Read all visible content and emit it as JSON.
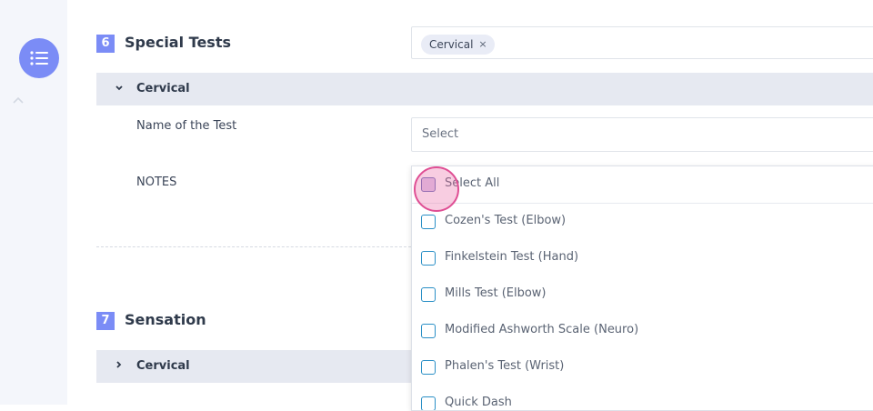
{
  "rail": {
    "menu_icon": "list-icon",
    "up_icon": "chevron-up-icon"
  },
  "sections": [
    {
      "number": "6",
      "title": "Special Tests"
    },
    {
      "number": "7",
      "title": "Sensation"
    }
  ],
  "special_tests": {
    "chip_label": "Cervical",
    "chip_remove": "×",
    "band_label": "Cervical",
    "test_name_label": "Name of the Test",
    "select_placeholder": "Select",
    "notes_label": "NOTES"
  },
  "sensation": {
    "band_label": "Cervical"
  },
  "dropdown": {
    "select_all": "Select All",
    "options": [
      "Cozen's Test (Elbow)",
      "Finkelstein Test (Hand)",
      "Mills Test (Elbow)",
      "Modified Ashworth Scale (Neuro)",
      "Phalen's Test (Wrist)",
      "Quick Dash"
    ]
  },
  "colors": {
    "accent": "#7b8cf6",
    "checkbox": "#2a8fc6",
    "band": "#e6e9f1"
  }
}
